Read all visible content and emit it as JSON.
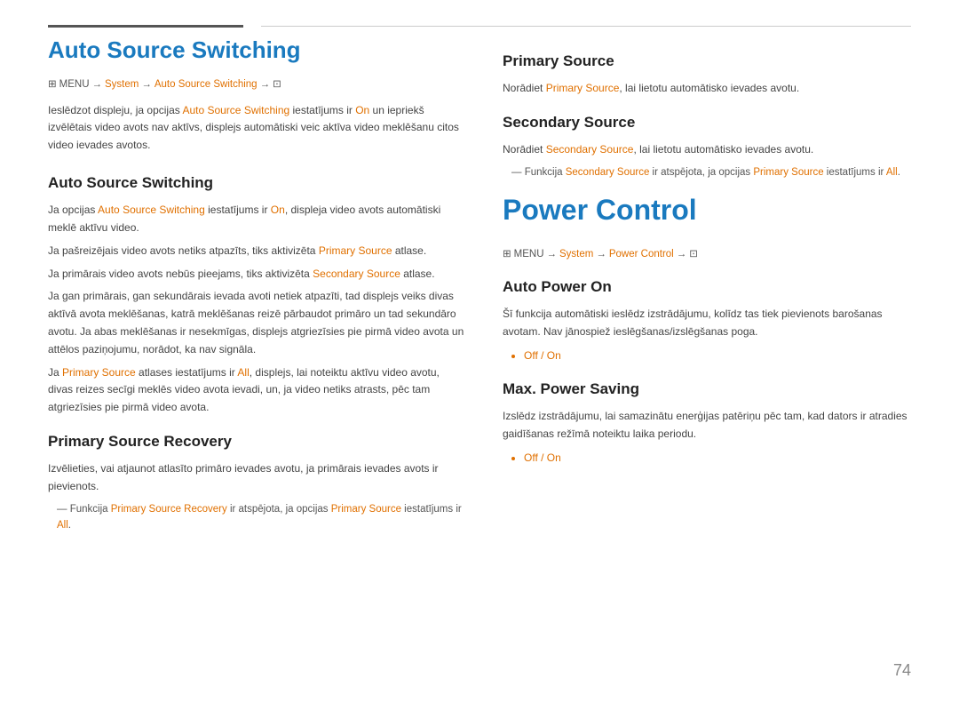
{
  "page": {
    "number": "74"
  },
  "topbar": {
    "left_line": true,
    "right_line": true
  },
  "left": {
    "main_title": "Auto Source Switching",
    "menu_path": {
      "prefix": "MENU",
      "arrow1": "→",
      "item1": "System",
      "arrow2": "→",
      "item2": "Auto Source Switching",
      "arrow3": "→",
      "icon": "⊡"
    },
    "intro": "Ieslēdzot displeju, ja opcijas Auto Source Switching iestatījums ir On un iepriekš izvēlētais video avots nav aktīvs, displejs automātiski veic aktīva video meklēšanu citos video ievades avotos.",
    "section1": {
      "title": "Auto Source Switching",
      "paragraphs": [
        "Ja opcijas Auto Source Switching iestatījums ir On, displeja video avots automātiski meklē aktīvu video.",
        "Ja pašreizējais video avots netiks atpazīts, tiks aktivizēta Primary Source atlase.",
        "Ja primārais video avots nebūs pieejams, tiks aktivizēta Secondary Source atlase.",
        "Ja gan primārais, gan sekundārais ievada avoti netiek atpazīti, tad displejs veiks divas aktīvā avota meklēšanas, katrā meklēšanas reizē pārbaudot primāro un tad sekundāro avotu. Ja abas meklēšanas ir nesekmīgas, displejs atgriezīsies pie pirmā video avota un attēlos paziņojumu, norādot, ka nav signāla.",
        "Ja Primary Source atlases iestatījums ir All, displejs, lai noteiktu aktīvu video avotu, divas reizes secīgi meklēs video avota ievadi, un, ja video netiks atrasts, pēc tam atgriezīsies pie pirmā video avota."
      ]
    },
    "section2": {
      "title": "Primary Source Recovery",
      "paragraph": "Izvēlieties, vai atjaunot atlasīto primāro ievades avotu, ja primārais ievades avots ir pievienots.",
      "note": "Funkcija Primary Source Recovery ir atspējota, ja opcijas Primary Source iestatījums ir All."
    }
  },
  "right": {
    "section_primary": {
      "title": "Primary Source",
      "text": "Norādiet Primary Source, lai lietotu automātisko ievades avotu."
    },
    "section_secondary": {
      "title": "Secondary Source",
      "text": "Norādiet Secondary Source, lai lietotu automātisko ievades avotu.",
      "note": "Funkcija Secondary Source ir atspējota, ja opcijas Primary Source iestatījums ir All."
    },
    "power_control": {
      "title": "Power Control",
      "menu_path": {
        "prefix": "MENU",
        "arrow1": "→",
        "item1": "System",
        "arrow2": "→",
        "item2": "Power Control",
        "arrow3": "→",
        "icon": "⊡"
      }
    },
    "auto_power_on": {
      "title": "Auto Power On",
      "text": "Šī funkcija automātiski ieslēdz izstrādājumu, kolīdz tas tiek pievienots barošanas avotam. Nav jānospiež ieslēgšanas/izslēgšanas poga.",
      "bullet": "Off / On"
    },
    "max_power_saving": {
      "title": "Max. Power Saving",
      "text": "Izslēdz izstrādājumu, lai samazinātu enerģijas patēriņu pēc tam, kad dators ir atradies gaidīšanas režīmā noteiktu laika periodu.",
      "bullet": "Off / On"
    }
  }
}
